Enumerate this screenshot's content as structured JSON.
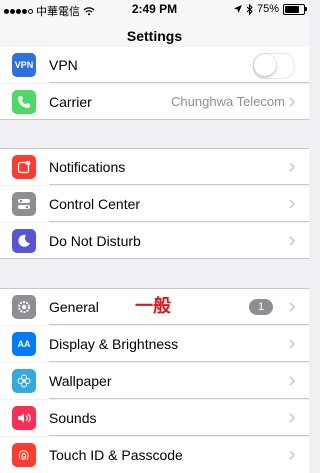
{
  "status_bar": {
    "carrier": "中華電信",
    "time": "2:49 PM",
    "battery": "75%",
    "battery_level": 0.75
  },
  "navbar": {
    "title": "Settings"
  },
  "rows": {
    "vpn": {
      "label": "VPN",
      "icon_text": "VPN",
      "icon_color": "#2f6fdf",
      "toggle_on": false
    },
    "carrier": {
      "label": "Carrier",
      "detail": "Chunghwa Telecom",
      "icon_color": "#4cd964"
    },
    "notifications": {
      "label": "Notifications",
      "icon_color": "#ff3b30"
    },
    "control_center": {
      "label": "Control Center",
      "icon_color": "#8e8e93"
    },
    "do_not_disturb": {
      "label": "Do Not Disturb",
      "icon_color": "#5856d6"
    },
    "general": {
      "label": "General",
      "badge": "1",
      "icon_color": "#8e8e93"
    },
    "display": {
      "label": "Display & Brightness",
      "icon_text": "AA",
      "icon_color": "#007aff"
    },
    "wallpaper": {
      "label": "Wallpaper",
      "icon_color": "#34aadc"
    },
    "sounds": {
      "label": "Sounds",
      "icon_color": "#ff2d55"
    },
    "touch_id": {
      "label": "Touch ID & Passcode",
      "icon_color": "#ff3b30"
    }
  },
  "annotation": {
    "text": "一般",
    "color": "#e01818"
  }
}
